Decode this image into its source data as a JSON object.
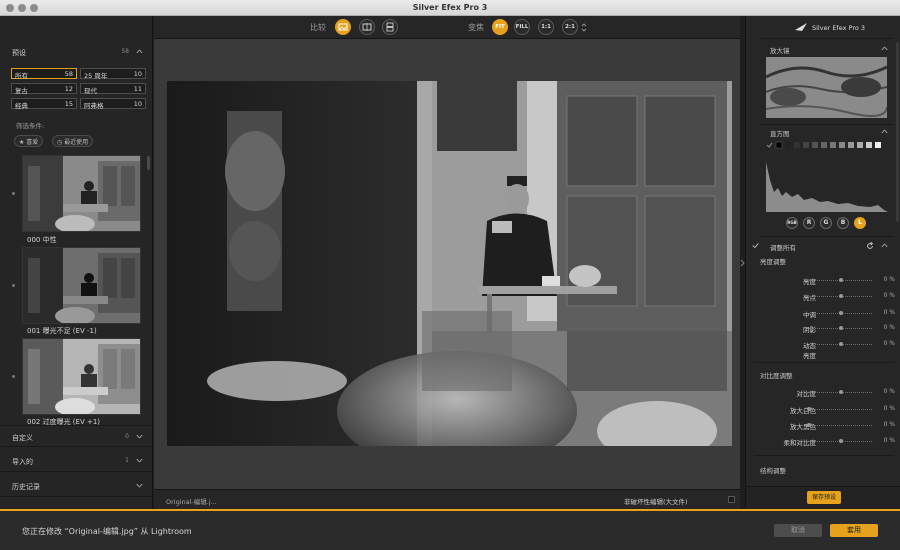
{
  "window": {
    "title": "Silver Efex Pro 3"
  },
  "left_panel": {
    "presets": {
      "label": "预设",
      "count": "58"
    },
    "categories": [
      {
        "name": "所有",
        "count": "58"
      },
      {
        "name": "25 周年",
        "count": "10"
      },
      {
        "name": "复古",
        "count": "12"
      },
      {
        "name": "现代",
        "count": "11"
      },
      {
        "name": "经典",
        "count": "15"
      },
      {
        "name": "阿弗格",
        "count": "10"
      }
    ],
    "filter_label": "筛选条件:",
    "filters": [
      "喜爱",
      "最近使用"
    ],
    "thumbnails": [
      {
        "label": "000 中性"
      },
      {
        "label": "001 曝光不足 (EV -1)"
      },
      {
        "label": "002 过度曝光 (EV +1)"
      }
    ],
    "sections": [
      {
        "label": "自定义",
        "count": "0"
      },
      {
        "label": "导入的",
        "count": "1"
      },
      {
        "label": "历史记录",
        "count": ""
      }
    ]
  },
  "toolbar": {
    "compare_label": "比较",
    "zoom_label": "变焦",
    "zoom_buttons": [
      "FIT",
      "FILL",
      "1:1",
      "2:1"
    ]
  },
  "statusbar": {
    "filename": "Original-编辑.j...",
    "mode": "非破坏性编辑(大文件)"
  },
  "right_panel": {
    "brand": "Silver Efex Pro 3",
    "loupe_label": "放大镜",
    "histogram_label": "直方图",
    "histogram_channels": [
      "RGB",
      "R",
      "G",
      "B",
      "L"
    ],
    "adjust_all_label": "调整所有",
    "brightness_label": "亮度调整",
    "brightness_sliders": [
      {
        "label": "亮度",
        "value": "0 %"
      },
      {
        "label": "亮点",
        "value": "0 %"
      },
      {
        "label": "中调",
        "value": "0 %"
      },
      {
        "label": "阴影",
        "value": "0 %"
      },
      {
        "label": "动态",
        "value": "0 %"
      },
      {
        "label": "亮度",
        "value": ""
      }
    ],
    "contrast_label": "对比度调整",
    "contrast_sliders": [
      {
        "label": "对比度",
        "value": "0 %"
      },
      {
        "label": "放大白色",
        "value": "0 %"
      },
      {
        "label": "放大黑色",
        "value": "0 %"
      },
      {
        "label": "柔和对比度",
        "value": "0 %"
      }
    ],
    "structure_label": "结构调整",
    "save_preset": "保存预设"
  },
  "bottom_bar": {
    "message": "您正在修改 “Original-编辑.jpg” 从 Lightroom",
    "cancel": "取消",
    "apply": "套用"
  },
  "colors": {
    "accent": "#e6a21c",
    "panel": "#262626",
    "canvas": "#3a3a3a"
  }
}
